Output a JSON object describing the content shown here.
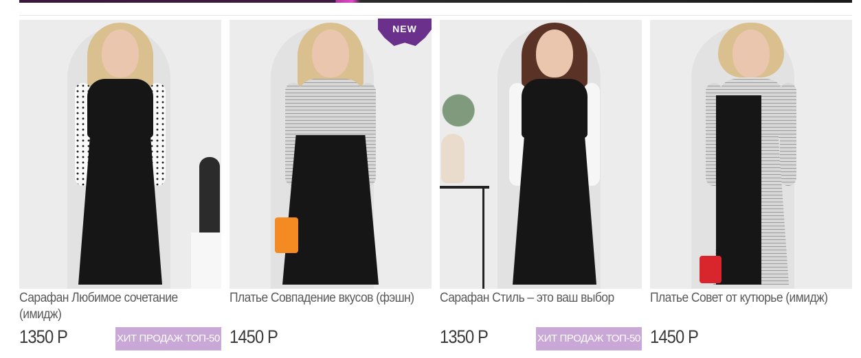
{
  "badges": {
    "new": "NEW",
    "hit": "ХИТ ПРОДАЖ ТОП-50"
  },
  "products": [
    {
      "name": "Сарафан Любимое сочетание (имидж)",
      "price": "1350 Р",
      "hit": "ХИТ ПРОДАЖ ТОП-50"
    },
    {
      "name": "Платье Совпадение вкусов (фэшн)",
      "price": "1450 Р",
      "new": "NEW"
    },
    {
      "name": "Сарафан Стиль – это ваш выбор",
      "price": "1350 Р",
      "hit": "ХИТ ПРОДАЖ ТОП-50"
    },
    {
      "name": "Платье Совет от кутюрье (имидж)",
      "price": "1450 Р"
    }
  ],
  "colors": {
    "accent_purple": "#6b2f8c",
    "hit_badge": "#c9a7d6"
  }
}
